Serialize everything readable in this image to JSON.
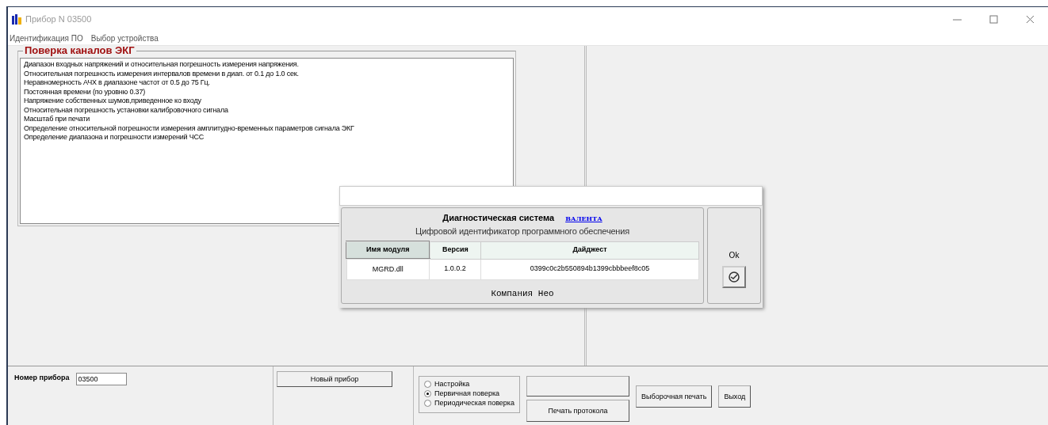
{
  "window": {
    "title": "Прибор N 03500"
  },
  "menu": [
    "Идентификация ПО",
    "Выбор устройства"
  ],
  "channels_group": {
    "title": "Поверка каналов ЭКГ",
    "items": [
      "Диапазон входных напряжений и относительная погрешность измерения напряжения.",
      "Относительная погрешность измерения интервалов времени в диап. от 0.1 до 1.0 сек.",
      "Неравномерность АЧХ в диапазоне частот от 0.5 до 75 Гц.",
      "Постоянная времени (по уровню 0.37)",
      "Напряжение собственных шумов,приведенное ко входу",
      "Относительная погрешность установки калибровочного сигнала",
      "Масштаб при печати",
      "Определение относительной погрешности  измерения амплитудно-временных параметров сигнала ЭКГ",
      "Определение диапазона и погрешности измерений ЧСС"
    ]
  },
  "dialog": {
    "heading": "Диагностическая система",
    "brand": "ВАЛЕНТА",
    "subtitle": "Цифровой идентификатор программного обеспечения",
    "table": {
      "columns": [
        "Имя модуля",
        "Версия",
        "Дайджест"
      ],
      "rows": [
        [
          "MGRD.dll",
          "1.0.0.2",
          "0399c0c2b550894b1399cbbbeef8c05"
        ]
      ]
    },
    "footer": "Компания Нео",
    "ok_label": "Ok"
  },
  "bottom": {
    "device_label": "Номер прибора",
    "device_number": "03500",
    "new_device_button": "Новый прибор",
    "modes": [
      {
        "label": "Настройка",
        "selected": false
      },
      {
        "label": "Первичная поверка",
        "selected": true
      },
      {
        "label": "Периодическая поверка",
        "selected": false
      }
    ],
    "print_protocol_button": "Печать протокола",
    "selective_print_button": "Выборочная печать",
    "exit_button": "Выход"
  }
}
